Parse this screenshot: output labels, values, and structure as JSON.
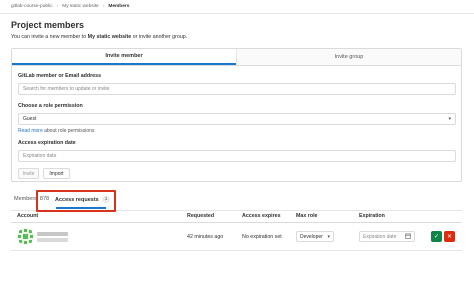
{
  "breadcrumb": {
    "items": [
      "gitlab-course-public",
      "My static website",
      "Members"
    ],
    "separator": "›"
  },
  "page_title": "Project members",
  "subtitle": {
    "prefix": "You can invite a new member to ",
    "project": "My static website",
    "suffix": " or invite another group."
  },
  "invite_tabs": {
    "member": "Invite member",
    "group": "Invite group"
  },
  "form": {
    "member_label": "GitLab member or Email address",
    "member_placeholder": "Search for members to update or invite",
    "role_label": "Choose a role permission",
    "role_value": "Guest",
    "role_help_link": "Read more",
    "role_help_suffix": " about role permissions",
    "expiration_label": "Access expiration date",
    "expiration_placeholder": "Expiration date",
    "invite_button": "Invite",
    "import_button": "Import"
  },
  "list_tabs": {
    "members_label": "Members",
    "members_count": "878",
    "requests_label": "Access requests",
    "requests_count": "1"
  },
  "table": {
    "headers": {
      "account": "Account",
      "requested": "Requested",
      "access_expires": "Access expires",
      "max_role": "Max role",
      "expiration": "Expiration"
    },
    "rows": [
      {
        "requested": "42 minutes ago",
        "access_expires": "No expiration set",
        "max_role": "Developer",
        "expiration_placeholder": "Expiration date"
      }
    ]
  },
  "icons": {
    "chevron": "chevron-down-icon",
    "calendar": "calendar-icon",
    "approve": "check-icon",
    "deny": "close-icon"
  },
  "colors": {
    "accent": "#1f75cb",
    "approve": "#108548",
    "deny": "#dd2b0e",
    "highlight": "#d9341b"
  }
}
